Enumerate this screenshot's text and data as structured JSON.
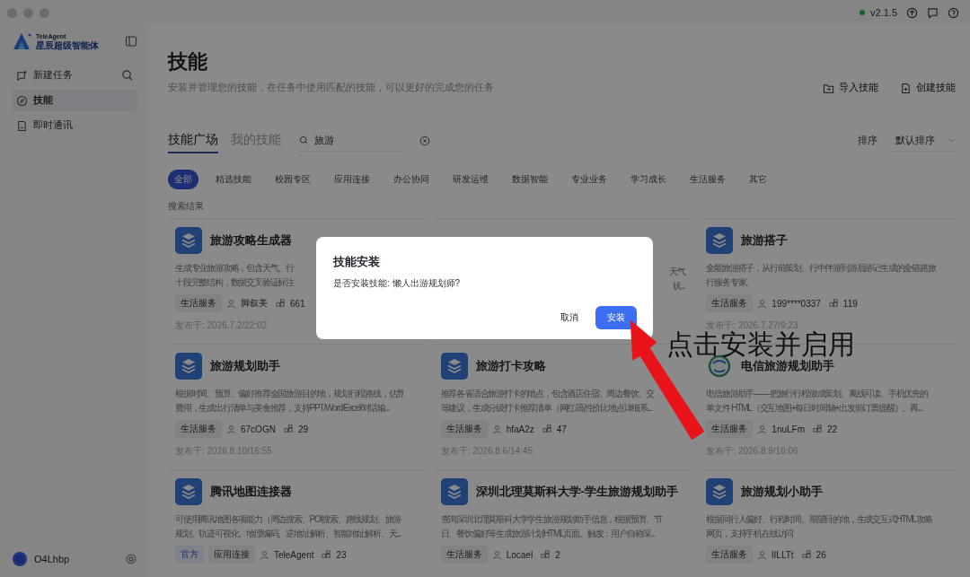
{
  "window": {
    "version": "v2.1.5"
  },
  "sidebar": {
    "brand_small": "TeleAgent",
    "brand_name": "星辰超级智能体",
    "items": [
      {
        "label": "新建任务",
        "selected": false
      },
      {
        "label": "技能",
        "selected": true
      },
      {
        "label": "即时通讯",
        "selected": false
      }
    ],
    "user": {
      "name": "O4Lhbp"
    }
  },
  "header": {
    "title": "技能",
    "subtitle": "安装并管理您的技能，在任务中使用匹配的技能，可以更好的完成您的任务",
    "actions": [
      {
        "label": "导入技能",
        "kind": "import"
      },
      {
        "label": "创建技能",
        "kind": "create"
      }
    ]
  },
  "tabs": [
    {
      "label": "技能广场",
      "selected": true
    },
    {
      "label": "我的技能",
      "selected": false
    }
  ],
  "search": {
    "value": "旅游"
  },
  "sort": {
    "label": "排序",
    "value": "默认排序"
  },
  "categories": [
    {
      "label": "全部",
      "selected": true
    },
    {
      "label": "精选技能",
      "selected": false
    },
    {
      "label": "校园专区",
      "selected": false
    },
    {
      "label": "应用连接",
      "selected": false
    },
    {
      "label": "办公协同",
      "selected": false
    },
    {
      "label": "研发运维",
      "selected": false
    },
    {
      "label": "数据智能",
      "selected": false
    },
    {
      "label": "专业业务",
      "selected": false
    },
    {
      "label": "学习成长",
      "selected": false
    },
    {
      "label": "生活服务",
      "selected": false
    },
    {
      "label": "其它",
      "selected": false
    }
  ],
  "results_label": "搜索结果",
  "cards": [
    {
      "kind": "skill",
      "title": "旅游攻略生成器",
      "description": [
        "生成专业旅游攻略，包含天气、行",
        "十段完整结构，数据交叉验证标注"
      ],
      "tags": [
        {
          "label": "生活服务",
          "kind": "category"
        }
      ],
      "author": "脚叙美",
      "count": "661",
      "published": "发布于: 2026.7.2/22:02"
    },
    {
      "kind": "covered",
      "description": [
        "天气",
        "状..."
      ]
    },
    {
      "kind": "skill",
      "title": "旅游搭子",
      "description": [
        "全能旅游搭子，从行前策划、行中伴游到游后游记生成的全链路旅",
        "行服务专家。"
      ],
      "tags": [
        {
          "label": "生活服务",
          "kind": "category"
        }
      ],
      "author": "199****0337",
      "count": "119",
      "published": "发布于: 2026.7.27/9:23"
    },
    {
      "kind": "skill",
      "title": "旅游规划助手",
      "description": [
        "根据时间、预算、偏好推荐全国旅游目的地，规划行程路线，估算",
        "费用，生成出行清单与美食推荐，支持PPT/Word/Excel/对话输..."
      ],
      "tags": [
        {
          "label": "生活服务",
          "kind": "category"
        }
      ],
      "author": "67cOGN",
      "count": "29",
      "published": "发布于: 2026.8.10/16:55"
    },
    {
      "kind": "skill",
      "title": "旅游打卡攻略",
      "description": [
        "推荐各省适合旅游打卡的地点，包含酒店住宿、周边餐饮、交",
        "等建议，生成分级打卡推荐清单（网红/高性价比地点详细系..."
      ],
      "tags": [
        {
          "label": "生活服务",
          "kind": "category"
        }
      ],
      "author": "hfaA2z",
      "count": "47",
      "published": "发布于: 2026.8.6/14:45"
    },
    {
      "kind": "skill",
      "title": "电信旅游规划助手",
      "description": [
        "电信旅游助手——把旅行行程做成策划、离线可读、手机优先的",
        "单文件 HTML（交互地图+每日时间轴+出发前订票提醒）。再..."
      ],
      "tags": [
        {
          "label": "生活服务",
          "kind": "category"
        }
      ],
      "author": "1nuLFm",
      "count": "22",
      "published": "发布于: 2026.8.9/16:06"
    },
    {
      "kind": "skill",
      "title": "腾讯地图连接器",
      "description": [
        "可使用腾讯地图各项能力（周边搜索、POI搜索、路线规划、旅游",
        "规划、轨迹可视化、地理编码、逆地址解析、智能地址解析、天..."
      ],
      "tags": [
        {
          "label": "官方",
          "kind": "official"
        },
        {
          "label": "应用连接",
          "kind": "category"
        }
      ],
      "author": "TeleAgent",
      "count": "23"
    },
    {
      "kind": "skill",
      "title": "深圳北理莫斯科大学-学生旅游规划助手",
      "description": [
        "查询深圳北理莫斯科大学学生旅游规划助手信息，根据预算、节",
        "日、餐饮偏好等生成旅游计划HTML页面。触发：用户自称深..."
      ],
      "tags": [
        {
          "label": "生活服务",
          "kind": "category"
        }
      ],
      "author": "Locael",
      "count": "2"
    },
    {
      "kind": "skill",
      "title": "旅游规划小助手",
      "description": [
        "根据同行人偏好、行程时间、期望目的地，生成交互式HTML攻略",
        "网页，支持手机在线访问"
      ],
      "tags": [
        {
          "label": "生活服务",
          "kind": "category"
        }
      ],
      "author": "lILLTt",
      "count": "26"
    }
  ],
  "dialog": {
    "title": "技能安装",
    "message": "是否安装技能: 懒人出游规划师?",
    "buttons": [
      {
        "label": "取消",
        "kind": "secondary"
      },
      {
        "label": "安装",
        "kind": "primary"
      }
    ]
  },
  "annotation": {
    "text": "点击安装并启用"
  }
}
